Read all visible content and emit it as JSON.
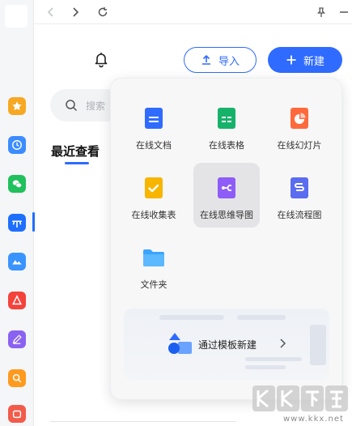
{
  "header": {
    "import_label": "导入",
    "new_label": "新建"
  },
  "search": {
    "placeholder": "搜索"
  },
  "recent": {
    "title": "最近查看"
  },
  "new_menu": {
    "items": [
      {
        "label": "在线文档",
        "icon": "online-doc-icon",
        "color": "#2f6bff"
      },
      {
        "label": "在线表格",
        "icon": "online-sheet-icon",
        "color": "#17b26a"
      },
      {
        "label": "在线幻灯片",
        "icon": "online-slides-icon",
        "color": "#ff6a3d"
      },
      {
        "label": "在线收集表",
        "icon": "online-form-icon",
        "color": "#f7b500"
      },
      {
        "label": "在线思维导图",
        "icon": "online-mindmap-icon",
        "color": "#8e5cf7"
      },
      {
        "label": "在线流程图",
        "icon": "online-flowchart-icon",
        "color": "#5a6cf0"
      },
      {
        "label": "文件夹",
        "icon": "folder-icon",
        "color": "#3aa4ff"
      }
    ],
    "template_label": "通过模板新建"
  },
  "watermark": {
    "url": "www.kkx.net"
  },
  "colors": {
    "accent": "#2f6bff",
    "hover_tile": "#e4e4e6"
  }
}
